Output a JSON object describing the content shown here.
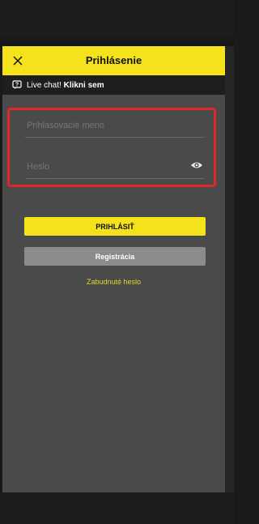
{
  "header": {
    "title": "Prihlásenie",
    "close_icon": "close-icon",
    "background": "#f4e21a"
  },
  "chat": {
    "icon": "chat-question-icon",
    "text": "Live chat!",
    "link_text": "Klikni sem"
  },
  "form": {
    "username_placeholder": "Prihlasovacie meno",
    "password_placeholder": "Heslo",
    "show_password_icon": "eye-icon",
    "highlight_color": "#e0262a"
  },
  "actions": {
    "login_label": "PRIHLÁSIŤ",
    "register_label": "Registrácia",
    "forgot_label": "Zabudnuté heslo",
    "login_color": "#f4e21a",
    "register_color": "#8b8b8b",
    "forgot_color": "#e6d42c"
  }
}
